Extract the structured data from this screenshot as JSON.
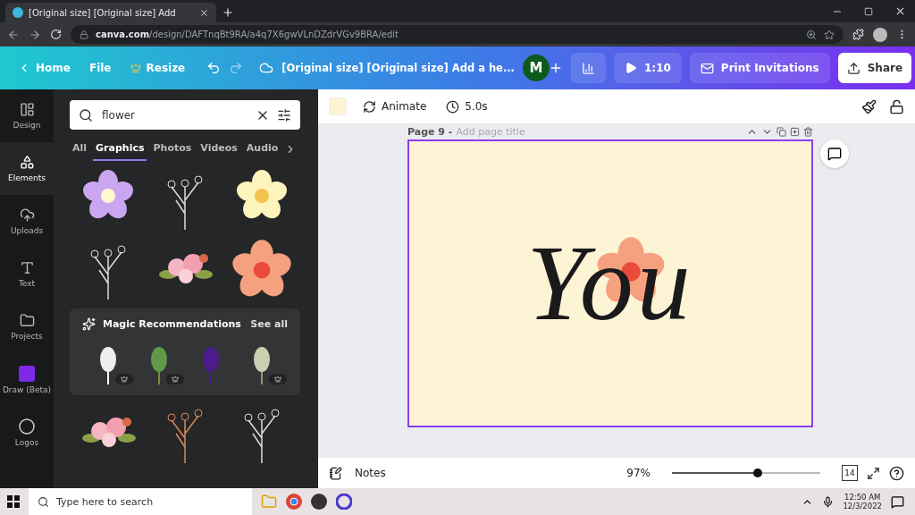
{
  "browser": {
    "tab_title": "[Original size] [Original size] Add",
    "url_domain": "canva.com",
    "url_path": "/design/DAFTnqBt9RA/a4q7X6gwVLnDZdrVGv9BRA/edit"
  },
  "topbar": {
    "home": "Home",
    "file": "File",
    "resize": "Resize",
    "doc_title": "[Original size] [Original size] Add a he...",
    "avatar": "M",
    "play_time": "1:10",
    "print": "Print Invitations",
    "share": "Share"
  },
  "rail": [
    {
      "label": "Design",
      "selected": false
    },
    {
      "label": "Elements",
      "selected": true
    },
    {
      "label": "Uploads",
      "selected": false
    },
    {
      "label": "Text",
      "selected": false
    },
    {
      "label": "Projects",
      "selected": false
    },
    {
      "label": "Draw (Beta)",
      "selected": false
    },
    {
      "label": "Logos",
      "selected": false
    }
  ],
  "search": {
    "value": "flower"
  },
  "filters": [
    {
      "label": "All",
      "selected": false
    },
    {
      "label": "Graphics",
      "selected": true
    },
    {
      "label": "Photos",
      "selected": false
    },
    {
      "label": "Videos",
      "selected": false
    },
    {
      "label": "Audio",
      "selected": false
    }
  ],
  "magic": {
    "title": "Magic Recommendations",
    "see_all": "See all",
    "items": [
      {
        "premium": true
      },
      {
        "premium": true
      },
      {
        "premium": false
      },
      {
        "premium": true
      }
    ]
  },
  "toolbar": {
    "animate": "Animate",
    "duration": "5.0s"
  },
  "page": {
    "label": "Page 9 -",
    "title_placeholder": "Add page title",
    "text": "You"
  },
  "bottom": {
    "notes": "Notes",
    "zoom": "97%",
    "level": 0.58,
    "pages": "14"
  },
  "taskbar": {
    "search_placeholder": "Type here to search",
    "time": "12:50 AM",
    "date": "12/3/2022"
  }
}
